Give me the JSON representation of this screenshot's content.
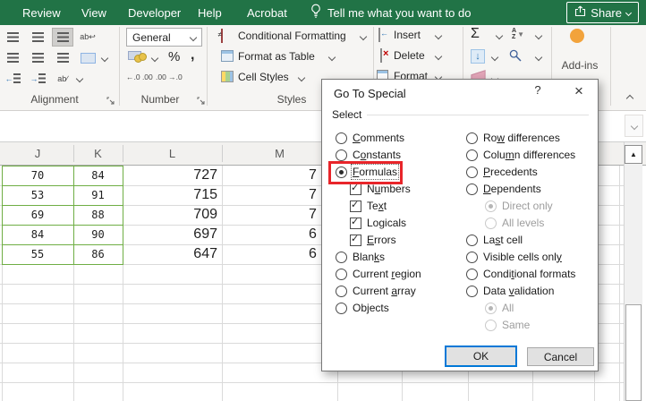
{
  "tabbar": {
    "tabs": [
      "Review",
      "View",
      "Developer",
      "Help",
      "Acrobat"
    ],
    "tell_me": "Tell me what you want to do",
    "share": "Share"
  },
  "ribbon": {
    "alignment": {
      "label": "Alignment"
    },
    "number": {
      "label": "Number",
      "format_value": "General",
      "percent": "%",
      "comma": ",",
      "inc_decimal": "←.0 .00",
      "dec_decimal": ".00 →.0"
    },
    "styles": {
      "label": "Styles",
      "conditional_formatting": "Conditional Formatting",
      "format_as_table": "Format as Table",
      "cell_styles": "Cell Styles"
    },
    "cells": {
      "insert": "Insert",
      "delete": "Delete",
      "format": "Format"
    },
    "editing": {
      "autosum_symbol": "Σ"
    },
    "addins": {
      "label": "Add-ins"
    }
  },
  "sheet": {
    "column_headers": [
      "J",
      "K",
      "L",
      "M"
    ],
    "rows": [
      {
        "j": "70",
        "k": "84",
        "l": "727",
        "m": "7"
      },
      {
        "j": "53",
        "k": "91",
        "l": "715",
        "m": "7"
      },
      {
        "j": "69",
        "k": "88",
        "l": "709",
        "m": "7"
      },
      {
        "j": "84",
        "k": "90",
        "l": "697",
        "m": "6"
      },
      {
        "j": "55",
        "k": "86",
        "l": "647",
        "m": "6"
      }
    ]
  },
  "dialog": {
    "title": "Go To Special",
    "help_button": "?",
    "close_button": "×",
    "section_label": "Select",
    "left_items": [
      {
        "label": "Comments",
        "type": "radio",
        "u": 0
      },
      {
        "label": "Constants",
        "type": "radio",
        "u": 1
      },
      {
        "label": "Formulas",
        "type": "radio",
        "u": 0,
        "checked": true,
        "focused": true,
        "annotated": true
      },
      {
        "label": "Numbers",
        "type": "checkbox",
        "u": 1,
        "checked": true,
        "indent": 1
      },
      {
        "label": "Text",
        "type": "checkbox",
        "u": 2,
        "checked": true,
        "indent": 1
      },
      {
        "label": "Logicals",
        "type": "checkbox",
        "u": 2,
        "checked": true,
        "indent": 1
      },
      {
        "label": "Errors",
        "type": "checkbox",
        "u": 0,
        "checked": true,
        "indent": 1
      },
      {
        "label": "Blanks",
        "type": "radio",
        "u": 4
      },
      {
        "label": "Current region",
        "type": "radio",
        "u": 8
      },
      {
        "label": "Current array",
        "type": "radio",
        "u": 8
      },
      {
        "label": "Objects",
        "type": "radio",
        "u": 2
      }
    ],
    "right_items": [
      {
        "label": "Row differences",
        "type": "radio",
        "u": 2
      },
      {
        "label": "Column differences",
        "type": "radio",
        "u": 4
      },
      {
        "label": "Precedents",
        "type": "radio",
        "u": 0
      },
      {
        "label": "Dependents",
        "type": "radio",
        "u": 0
      },
      {
        "label": "Direct only",
        "type": "radio",
        "disabled": true,
        "checked": true,
        "indent": 1
      },
      {
        "label": "All levels",
        "type": "radio",
        "disabled": true,
        "indent": 1
      },
      {
        "label": "Last cell",
        "type": "radio",
        "u": 2
      },
      {
        "label": "Visible cells only",
        "type": "radio",
        "u": 17
      },
      {
        "label": "Conditional formats",
        "type": "radio",
        "u": 5
      },
      {
        "label": "Data validation",
        "type": "radio",
        "u": 5
      },
      {
        "label": "All",
        "type": "radio",
        "disabled": true,
        "checked": true,
        "indent": 1
      },
      {
        "label": "Same",
        "type": "radio",
        "disabled": true,
        "indent": 1
      }
    ],
    "ok": "OK",
    "cancel": "Cancel"
  },
  "colors": {
    "ribbon_green": "#217346",
    "selection_green": "#6fae44",
    "annotation_red": "#e8252a",
    "focus_blue": "#0078d7",
    "addins_orange": "#f2a33c"
  }
}
